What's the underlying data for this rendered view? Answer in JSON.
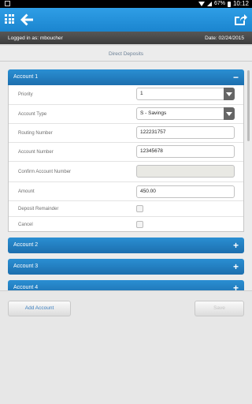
{
  "status_bar": {
    "battery": "67%",
    "time": "10:12"
  },
  "header": {
    "logged_in": "Logged in as: mboucher",
    "date": "Date: 02/24/2015"
  },
  "page_title": "Direct Deposits",
  "accounts": [
    {
      "label": "Account 1",
      "toggle": "−",
      "expanded": true
    },
    {
      "label": "Account 2",
      "toggle": "+",
      "expanded": false
    },
    {
      "label": "Account 3",
      "toggle": "+",
      "expanded": false
    },
    {
      "label": "Account 4",
      "toggle": "+",
      "expanded": false
    }
  ],
  "form": {
    "priority": {
      "label": "Priority",
      "value": "1"
    },
    "account_type": {
      "label": "Account Type",
      "value": "S - Savings"
    },
    "routing_number": {
      "label": "Routing Number",
      "value": "122231757"
    },
    "account_number": {
      "label": "Account Number",
      "value": "12345678"
    },
    "confirm_account_number": {
      "label": "Confirm Account Number",
      "value": ""
    },
    "amount": {
      "label": "Amount",
      "value": "450.00"
    },
    "deposit_remainder": {
      "label": "Deposit Remainder",
      "checked": false
    },
    "cancel": {
      "label": "Cancel",
      "checked": false
    }
  },
  "footer": {
    "add_label": "Add Account",
    "save_label": "Save"
  },
  "colors": {
    "nav_blue": "#1b85cf",
    "accordion_blue": "#1d6fae",
    "dark_bar": "#3c3c3c"
  },
  "icons": {
    "apps": "grid-icon",
    "back": "back-arrow-icon",
    "share": "share-icon"
  }
}
